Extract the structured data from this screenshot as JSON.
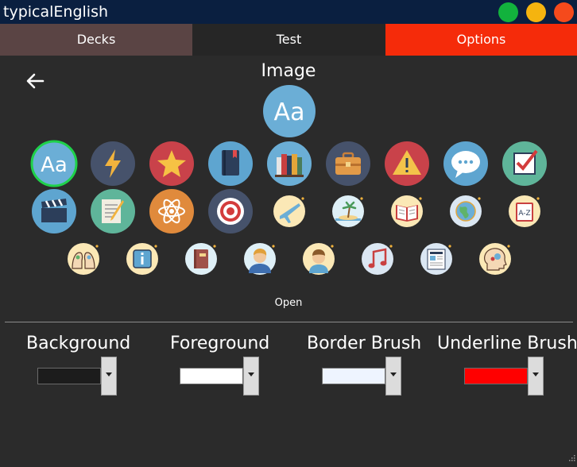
{
  "app": {
    "title": "typicalEnglish"
  },
  "window_buttons": {
    "green": "#12b23d",
    "yellow": "#f5b40f",
    "red": "#f54a1c"
  },
  "tabs": [
    {
      "label": "Decks",
      "color": "#5a4444"
    },
    {
      "label": "Test",
      "color": "#262626"
    },
    {
      "label": "Options",
      "color": "#f52b0a"
    }
  ],
  "image_section": {
    "title": "Image",
    "open_label": "Open"
  },
  "icons": [
    "letters-aa-icon",
    "lightning-icon",
    "star-icon",
    "book-icon",
    "books-stack-icon",
    "briefcase-icon",
    "warning-icon",
    "speech-bubble-icon",
    "checkbox-icon",
    "clapperboard-icon",
    "notepad-pencil-icon",
    "atom-icon",
    "target-icon",
    "airplane-icon",
    "beach-island-icon",
    "open-book-icon",
    "globe-icon",
    "dictionary-az-icon",
    "two-heads-puzzle-icon",
    "info-icon",
    "journal-icon",
    "man-avatar-icon",
    "boy-avatar-icon",
    "music-note-icon",
    "newspaper-icon",
    "brain-gears-icon"
  ],
  "colors_section": [
    {
      "label": "Background",
      "swatch": "#1c1c1c"
    },
    {
      "label": "Foreground",
      "swatch": "#ffffff"
    },
    {
      "label": "Border Brush",
      "swatch": "#eef4ff"
    },
    {
      "label": "Underline Brush",
      "swatch": "#ff0000"
    }
  ]
}
